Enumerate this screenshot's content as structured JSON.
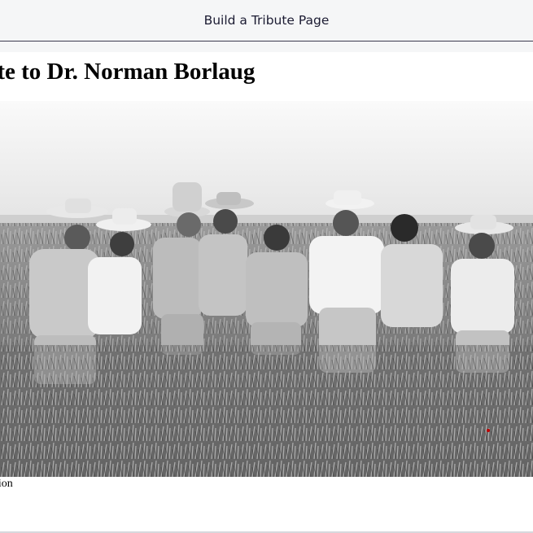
{
  "header": {
    "title": "Build a Tribute Page"
  },
  "tribute": {
    "heading": "ibute to Dr. Norman Borlaug",
    "caption": "ption"
  },
  "colors": {
    "header_bg": "#f5f6f7",
    "header_text": "#1b1b32",
    "page_bg": "#ffffff"
  }
}
